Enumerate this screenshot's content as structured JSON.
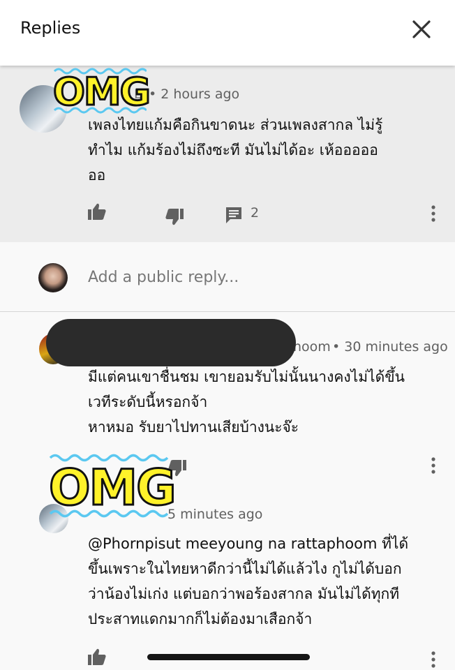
{
  "header": {
    "title": "Replies",
    "close_icon": "close-icon"
  },
  "comment1": {
    "author_fragment": "L",
    "timestamp": "• 2 hours ago",
    "text_line1": "เพลงไทยแก้มคือกินขาดนะ ส่วนเพลงสากล ไม่รู้",
    "text_line2": "ทำไม แก้มร้องไม่ถึงซะที มันไม่ได้อะ เห้อออออ",
    "text_line3": "ออ",
    "reply_count": "2"
  },
  "reply_input": {
    "placeholder": "Add a public reply..."
  },
  "comment2": {
    "author_fragment": "hoom",
    "timestamp": "• 30 minutes ago",
    "text_line1": "มีแต่คนเขาชื่นชม เขายอมรับไม่นั้นนางคงไม่ได้ขึ้น",
    "text_line2": "เวทีระดับนี้หรอกจ้า",
    "text_line3": "หาหมอ รับยาไปทานเสียบ้างนะจ๊ะ"
  },
  "comment3": {
    "timestamp": "5 minutes ago",
    "text_line1": "@Phornpisut meeyoung na rattaphoom ที่ได้",
    "text_line2": "ขึ้นเพราะในไทยหาดีกว่านี้ไม่ได้แล้วไง กูไม่ได้บอก",
    "text_line3": "ว่าน้องไม่เก่ง แต่บอกว่าพอร้องสากล มันไม่ได้ทุกที",
    "text_line4": "ประสาทแดกมากก็ไม่ต้องมาเสือกจ้า"
  },
  "stickers": {
    "omg_text": "OMG"
  },
  "colors": {
    "omg_fill": "#fff22a",
    "wave": "#5bc8f0",
    "redaction": "#2b2b2b"
  }
}
